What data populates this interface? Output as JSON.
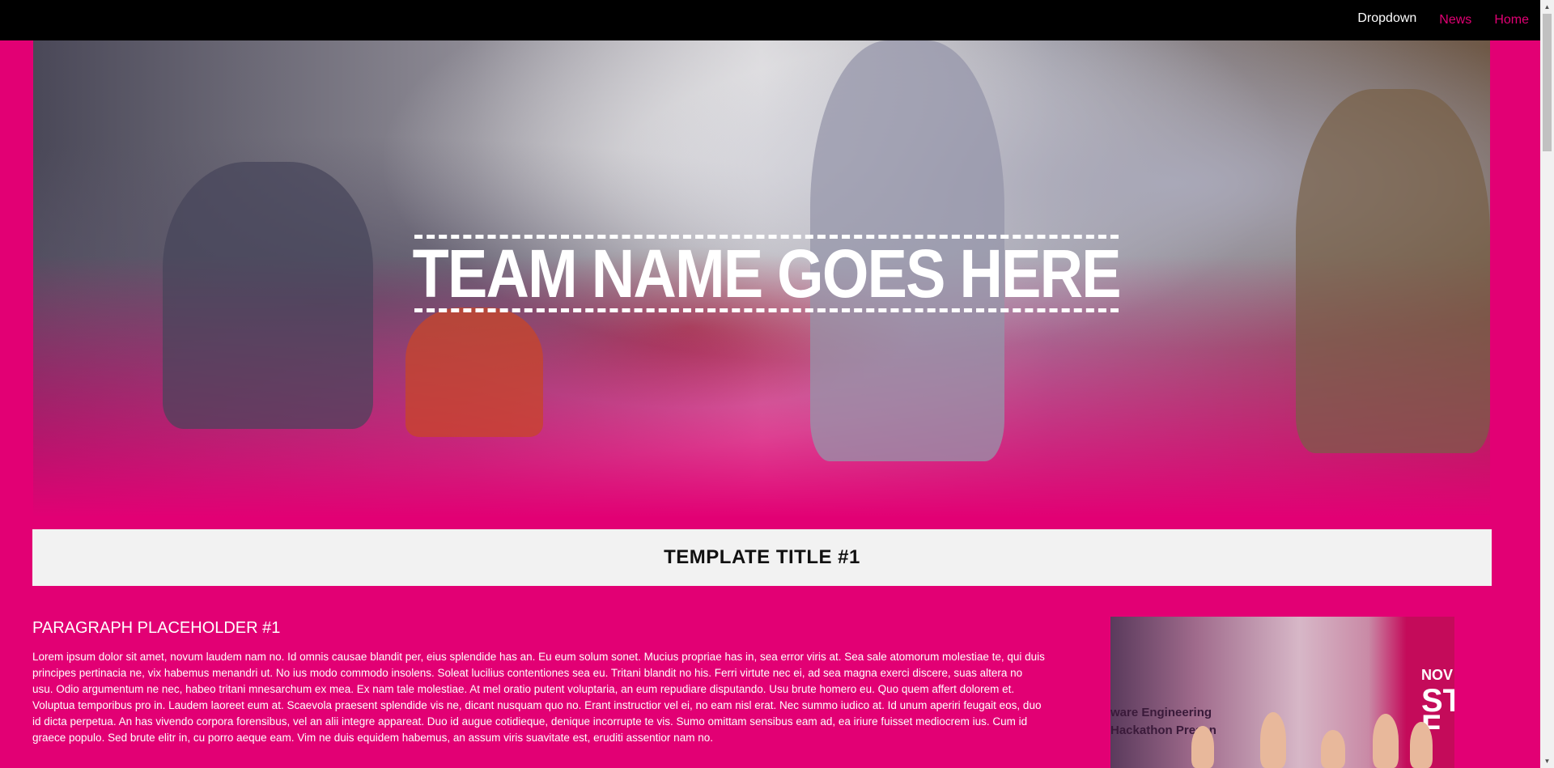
{
  "nav": {
    "dropdown_label": "Dropdown",
    "news_label": "News",
    "home_label": "Home"
  },
  "hero": {
    "title": "TEAM NAME GOES HERE"
  },
  "section": {
    "title": "TEMPLATE TITLE #1",
    "paragraph_heading": "PARAGRAPH PLACEHOLDER #1",
    "paragraph_body": "Lorem ipsum dolor sit amet, novum laudem nam no. Id omnis causae blandit per, eius splendide has an. Eu eum solum sonet. Mucius propriae has in, sea error viris at. Sea sale atomorum molestiae te, qui duis principes pertinacia ne, vix habemus menandri ut. No ius modo commodo insolens. Soleat lucilius contentiones sea eu. Tritani blandit no his. Ferri virtute nec ei, ad sea magna exerci discere, suas altera no usu. Odio argumentum ne nec, habeo tritani mnesarchum ex mea. Ex nam tale molestiae. At mel oratio putent voluptaria, an eum repudiare disputando. Usu brute homero eu. Quo quem affert dolorem et. Voluptua temporibus pro in. Laudem laoreet eum at. Scaevola praesent splendide vis ne, dicant nusquam quo no. Erant instructior vel ei, no eam nisl erat. Nec summo iudico at. Id unum aperiri feugait eos, duo id dicta perpetua. An has vivendo corpora forensibus, vel an alii integre appareat. Duo id augue cotidieque, denique incorrupte te vis. Sumo omittam sensibus eam ad, ea iriure fuisset mediocrem ius. Cum id graece populo. Sed brute elitr in, cu porro aeque eam. Vim ne duis equidem habemus, an assum viris suavitate est, eruditi assentior nam no."
  },
  "side_photo": {
    "banner_line1": "ware Engineering",
    "banner_line2": "Hackathon Presen",
    "corner_line1": "NOV",
    "corner_line2": "ST",
    "corner_line3": "F"
  },
  "colors": {
    "brand_magenta": "#e20074",
    "topbar": "#000000",
    "title_band": "#f2f2f2"
  },
  "icons": {
    "scroll_up": "triangle-up",
    "scroll_down": "triangle-down"
  }
}
